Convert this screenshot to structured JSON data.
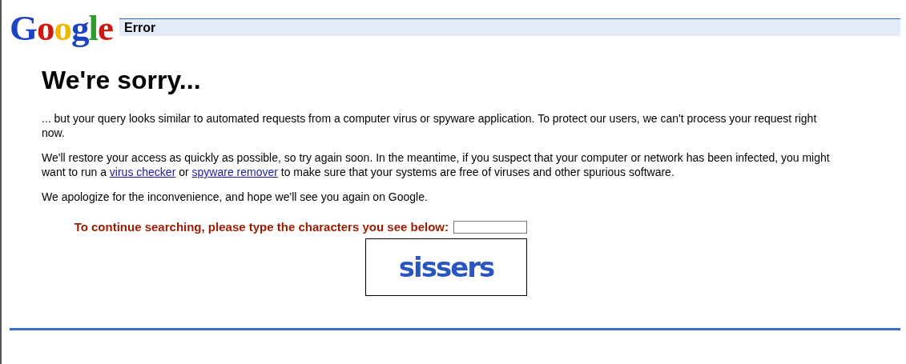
{
  "logo": {
    "text": "Google"
  },
  "header": {
    "title": "Error"
  },
  "heading": "We're sorry...",
  "paragraphs": [
    {
      "parts": [
        {
          "kind": "text",
          "text": "... but your query looks similar to automated requests from a computer virus or spyware application. To protect our users, we can't process your request right now."
        }
      ]
    },
    {
      "parts": [
        {
          "kind": "text",
          "text": "We'll restore your access as quickly as possible, so try again soon. In the meantime, if you suspect that your computer or network has been infected, you might want to run a "
        },
        {
          "kind": "link",
          "text": "virus checker"
        },
        {
          "kind": "text",
          "text": " or "
        },
        {
          "kind": "link",
          "text": "spyware remover"
        },
        {
          "kind": "text",
          "text": " to make sure that your systems are free of viruses and other spurious software."
        }
      ]
    },
    {
      "parts": [
        {
          "kind": "text",
          "text": "We apologize for the inconvenience, and hope we'll see you again on Google."
        }
      ]
    }
  ],
  "captcha": {
    "prompt": "To continue searching, please type the characters you see below:",
    "characters": "sissers"
  }
}
